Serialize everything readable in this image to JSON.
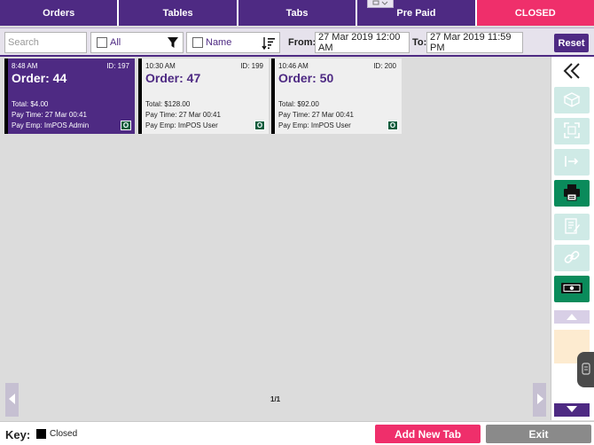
{
  "tabs": [
    {
      "label": "Orders",
      "active": false
    },
    {
      "label": "Tables",
      "active": false
    },
    {
      "label": "Tabs",
      "active": false
    },
    {
      "label": "Pre Paid",
      "active": false
    },
    {
      "label": "CLOSED",
      "active": true
    }
  ],
  "filters": {
    "search_placeholder": "Search",
    "all_label": "All",
    "name_label": "Name",
    "from_label": "From:",
    "from_value": "27 Mar 2019 12:00 AM",
    "to_label": "To:",
    "to_value": "27 Mar 2019 11:59 PM",
    "reset_label": "Reset"
  },
  "orders": [
    {
      "time": "8:48 AM",
      "id": "ID: 197",
      "order": "Order: 44",
      "total": "Total: $4.00",
      "pay_time": "Pay Time: 27 Mar 00:41",
      "pay_emp": "Pay Emp: ImPOS Admin",
      "badge": "O",
      "selected": true
    },
    {
      "time": "10:30 AM",
      "id": "ID: 199",
      "order": "Order: 47",
      "total": "Total: $128.00",
      "pay_time": "Pay Time: 27 Mar 00:41",
      "pay_emp": "Pay Emp: ImPOS User",
      "badge": "O",
      "selected": false
    },
    {
      "time": "10:46 AM",
      "id": "ID: 200",
      "order": "Order: 50",
      "total": "Total: $92.00",
      "pay_time": "Pay Time: 27 Mar 00:41",
      "pay_emp": "Pay Emp: ImPOS User",
      "badge": "O",
      "selected": false
    }
  ],
  "pager": {
    "label": "1/1"
  },
  "key": {
    "label": "Key:",
    "closed_label": "Closed"
  },
  "actions": {
    "add_new_tab": "Add New Tab",
    "exit": "Exit"
  },
  "colors": {
    "brand_purple": "#4e2a83",
    "accent_pink": "#ef2f6b",
    "toolbar_green": "#0a8b5b",
    "badge_green": "#0c5c3c",
    "exit_gray": "#8a8a8a"
  },
  "sidebar_icons": [
    "collapse-icon",
    "open-box-icon",
    "split-icon",
    "transfer-icon",
    "printer-icon",
    "edit-receipt-icon",
    "link-icon",
    "cash-icon",
    "scroll-up-icon",
    "scroll-down-icon"
  ]
}
